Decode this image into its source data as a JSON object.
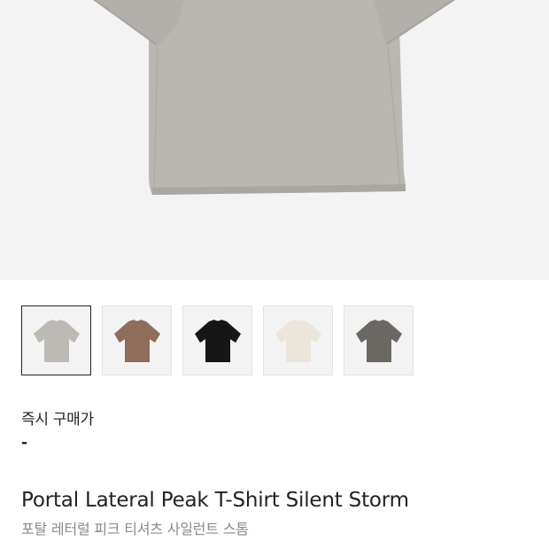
{
  "product": {
    "main_image": {
      "color": "#b9b5b1",
      "icon": "tshirt-photo"
    },
    "thumbnails": [
      {
        "name": "thumb-grey",
        "color": "#bdb9b5",
        "selected": true
      },
      {
        "name": "thumb-brown",
        "color": "#8e6d5b",
        "selected": false
      },
      {
        "name": "thumb-black",
        "color": "#161616",
        "selected": false
      },
      {
        "name": "thumb-ivory",
        "color": "#ece6da",
        "selected": false
      },
      {
        "name": "thumb-charcoal",
        "color": "#6b6762",
        "selected": false
      }
    ],
    "price_label": "즉시 구매가",
    "price_value": "-",
    "title": "Portal Lateral Peak T-Shirt Silent Storm",
    "subtitle": "포탈 레터럴 피크 티셔츠 사일런트 스톰"
  }
}
